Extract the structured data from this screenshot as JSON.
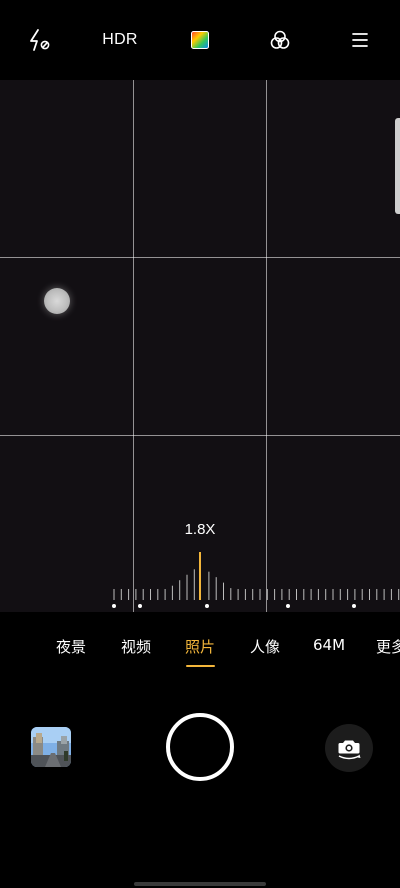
{
  "topbar": {
    "flash_icon": "flash-off-icon",
    "hdr_label": "HDR",
    "color_mode_icon": "color-palette-icon",
    "filter_icon": "filter-circles-icon",
    "menu_icon": "menu-icon"
  },
  "viewfinder": {
    "zoom_label": "1.8X",
    "zoom_value": 1.8,
    "grid": "3x3",
    "focus_indicator_icon": "focus-dot-icon"
  },
  "modes": {
    "items": [
      {
        "label": "夜景",
        "active": false
      },
      {
        "label": "视频",
        "active": false
      },
      {
        "label": "照片",
        "active": true
      },
      {
        "label": "人像",
        "active": false
      },
      {
        "label": "64M",
        "active": false
      },
      {
        "label": "更多",
        "active": false
      }
    ]
  },
  "bottom": {
    "gallery_thumbnail_icon": "gallery-thumbnail-icon",
    "shutter_icon": "shutter-button-icon",
    "switch_camera_icon": "switch-camera-icon"
  },
  "colors": {
    "accent": "#f3b63b",
    "background": "#000000",
    "viewfinder": "#120f13"
  }
}
